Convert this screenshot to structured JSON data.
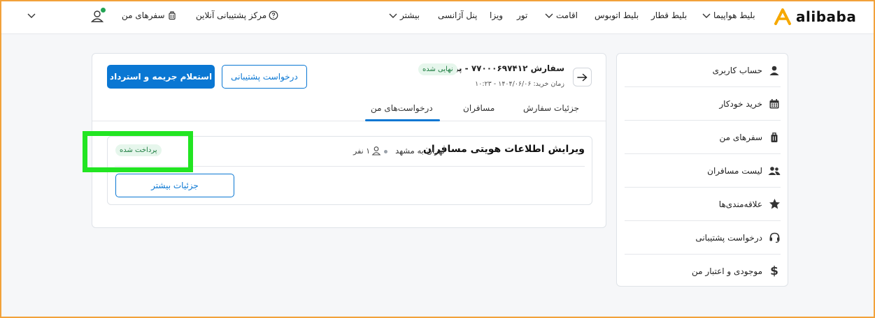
{
  "header": {
    "logo_text": "alibaba",
    "nav": {
      "flight": "بلیط هواپیما",
      "train": "بلیط قطار",
      "bus": "بلیط اتوبوس",
      "stay": "اقامت",
      "tour": "تور",
      "visa": "ویزا",
      "agency": "پنل آژانسی",
      "more": "بیشتر",
      "support": "مرکز پشتیبانی آنلاین",
      "my_trips": "سفرهای من"
    }
  },
  "sidebar": {
    "items": [
      {
        "label": "حساب کاربری",
        "icon": "user-icon"
      },
      {
        "label": "خرید خودکار",
        "icon": "calendar-icon"
      },
      {
        "label": "سفرهای من",
        "icon": "suitcase-icon"
      },
      {
        "label": "لیست مسافران",
        "icon": "users-icon"
      },
      {
        "label": "علاقه‌مندی‌ها",
        "icon": "star-icon"
      },
      {
        "label": "درخواست پشتیبانی",
        "icon": "headset-icon"
      },
      {
        "label": "موجودی و اعتبار من",
        "icon": "dollar-icon"
      }
    ]
  },
  "order": {
    "title": "سفارش ۷۷۰۰۰۶۹۷۴۱۲ - پرواز",
    "status": "نهایی شده",
    "date": "زمان خرید: ۱۴۰۴/۰۶/۰۶ - ۱۰:۲۳",
    "btn_refund": "استعلام جریمه و استرداد",
    "btn_support": "درخواست پشتیبانی"
  },
  "tabs": {
    "details": "جزئیات سفارش",
    "passengers": "مسافران",
    "requests": "درخواست‌های من",
    "active": "requests"
  },
  "request": {
    "title": "ویرایش اطلاعات هویتی مسافران",
    "route": "تهران به مشهد",
    "pax": "۱ نفر",
    "status": "پرداخت شده",
    "btn_more": "جزئیات بیشتر"
  },
  "colors": {
    "primary": "#0a77d3",
    "success_bg": "#e6f6ec",
    "success_text": "#1c7c3f",
    "highlight": "#22e522",
    "brand_orange": "#f2a13a"
  }
}
